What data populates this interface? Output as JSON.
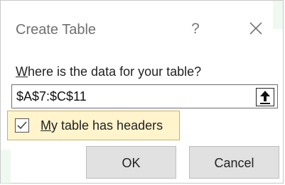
{
  "dialog": {
    "title": "Create Table",
    "help_glyph": "?",
    "close_icon": "close-icon"
  },
  "prompt": {
    "mnemonic": "W",
    "rest": "here is the data for your table?"
  },
  "range_field": {
    "value": "$A$7:$C$11",
    "collapse_icon": "arrow-up-icon"
  },
  "headers_checkbox": {
    "checked": true,
    "mnemonic": "M",
    "rest": "y table has headers",
    "highlight_color": "#fff4cc"
  },
  "buttons": {
    "ok_label": "OK",
    "cancel_label": "Cancel"
  }
}
